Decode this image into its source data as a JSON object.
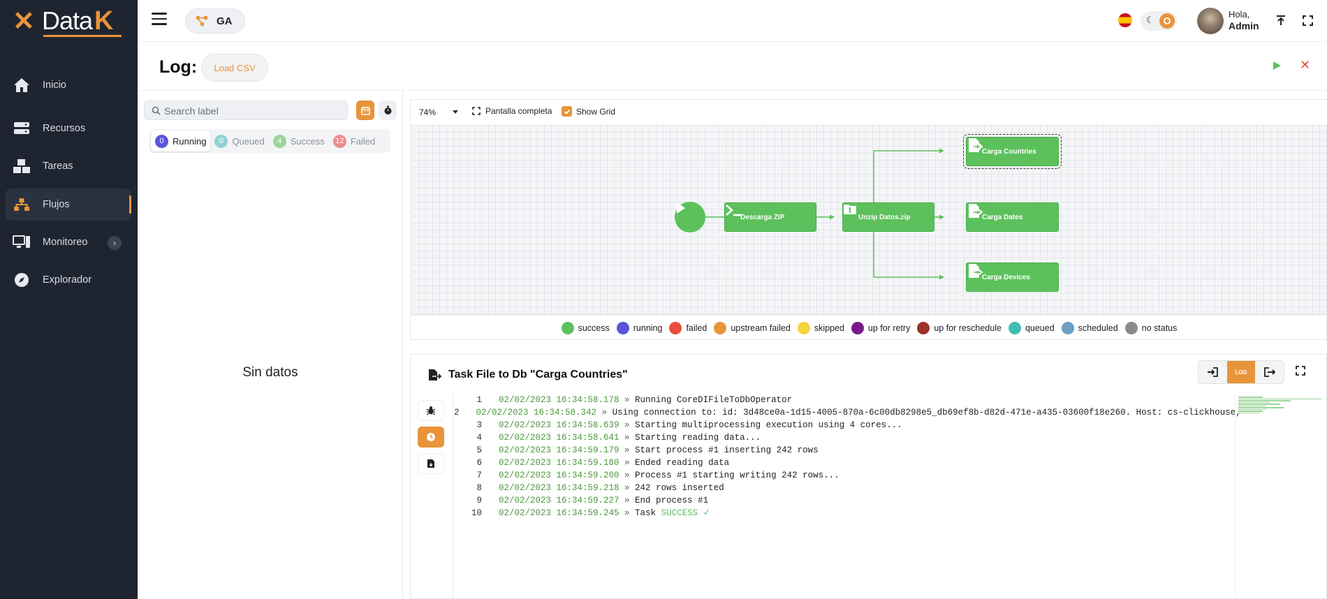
{
  "sidebar": {
    "logo_text": "Data",
    "logo_k": "K",
    "items": [
      {
        "label": "Inicio",
        "icon": "home-icon"
      },
      {
        "label": "Recursos",
        "icon": "server-icon"
      },
      {
        "label": "Tareas",
        "icon": "boxes-icon"
      },
      {
        "label": "Flujos",
        "icon": "sitemap-icon",
        "active": true
      },
      {
        "label": "Monitoreo",
        "icon": "monitor-icon",
        "expandable": true
      },
      {
        "label": "Explorador",
        "icon": "compass-icon"
      }
    ]
  },
  "topbar": {
    "workspace": "GA",
    "greeting": "Hola,",
    "user": "Admin",
    "language": "es",
    "theme_icon": "sun-icon"
  },
  "log_header": {
    "title": "Log:",
    "chip": "Load CSV"
  },
  "left_panel": {
    "search_placeholder": "Search label",
    "tabs": [
      {
        "label": "Running",
        "count": "0",
        "color": "#5a54d8",
        "active": true
      },
      {
        "label": "Queued",
        "count": "0",
        "color": "#8fd3d6"
      },
      {
        "label": "Success",
        "count": "4",
        "color": "#9ad59a"
      },
      {
        "label": "Failed",
        "count": "12",
        "color": "#ec8d8d"
      }
    ],
    "empty_text": "Sin datos"
  },
  "graph": {
    "zoom": "74%",
    "fullscreen_label": "Pantalla completa",
    "grid_label": "Show Grid",
    "show_grid": true,
    "nodes": {
      "descarga": "Descarga ZIP",
      "unzip": "Unzip Datos.zip",
      "countries": "Carga Countries",
      "dates": "Carga Dates",
      "devices": "Carga Devices"
    },
    "legend": [
      {
        "label": "success",
        "color": "#5cc15c"
      },
      {
        "label": "running",
        "color": "#5a54d8"
      },
      {
        "label": "failed",
        "color": "#e74c3c"
      },
      {
        "label": "upstream failed",
        "color": "#e8943a"
      },
      {
        "label": "skipped",
        "color": "#f5d43c"
      },
      {
        "label": "up for retry",
        "color": "#7a1a8a"
      },
      {
        "label": "up for reschedule",
        "color": "#a0302a"
      },
      {
        "label": "queued",
        "color": "#3dbdb6"
      },
      {
        "label": "scheduled",
        "color": "#6d9ec4"
      },
      {
        "label": "no status",
        "color": "#8a8a8a"
      }
    ]
  },
  "task": {
    "title": "Task File to Db \"Carga Countries\"",
    "log_btn": "LOG",
    "lines": [
      {
        "n": "1",
        "ts": "02/02/2023 16:34:58.178",
        "msg": "Running CoreDIFileToDbOperator"
      },
      {
        "n": "2",
        "ts": "02/02/2023 16:34:58.342",
        "msg": "Using connection to: id: 3d48ce0a-1d15-4005-870a-6c00db8298e5_db69ef8b-d82d-471e-a435-03600f18e260. Host: cs-clickhouse, P"
      },
      {
        "n": "3",
        "ts": "02/02/2023 16:34:58.639",
        "msg": "Starting multiprocessing execution using 4 cores..."
      },
      {
        "n": "4",
        "ts": "02/02/2023 16:34:58.641",
        "msg": "Starting reading data..."
      },
      {
        "n": "5",
        "ts": "02/02/2023 16:34:59.179",
        "msg": "Start process #1 inserting 242 rows"
      },
      {
        "n": "6",
        "ts": "02/02/2023 16:34:59.180",
        "msg": "Ended reading data"
      },
      {
        "n": "7",
        "ts": "02/02/2023 16:34:59.200",
        "msg": "Process #1 starting writing 242 rows..."
      },
      {
        "n": "8",
        "ts": "02/02/2023 16:34:59.218",
        "msg": "242 rows inserted"
      },
      {
        "n": "9",
        "ts": "02/02/2023 16:34:59.227",
        "msg": "End process #1"
      },
      {
        "n": "10",
        "ts": "02/02/2023 16:34:59.245",
        "msg": "Task ",
        "success": "SUCCESS ✓"
      }
    ]
  }
}
